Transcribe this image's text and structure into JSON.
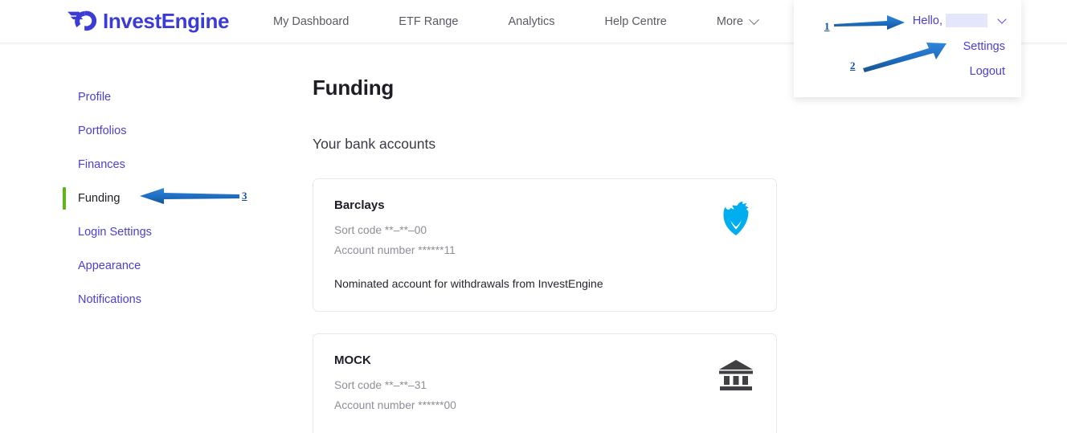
{
  "header": {
    "brand_name": "InvestEngine",
    "brand_logo_icon": "investengine-swoosh-ring-logo",
    "nav": [
      {
        "label": "My Dashboard",
        "icon": null
      },
      {
        "label": "ETF Range",
        "icon": null
      },
      {
        "label": "Analytics",
        "icon": null
      },
      {
        "label": "Help Centre",
        "icon": null
      },
      {
        "label": "More",
        "icon": "chevron-down-icon"
      }
    ]
  },
  "user_menu": {
    "greeting": "Hello,",
    "username_redacted": "",
    "chevron_icon": "chevron-down-icon",
    "items": [
      {
        "label": "Settings"
      },
      {
        "label": "Logout"
      }
    ]
  },
  "sidebar": {
    "items": [
      {
        "label": "Profile",
        "active": false
      },
      {
        "label": "Portfolios",
        "active": false
      },
      {
        "label": "Finances",
        "active": false
      },
      {
        "label": "Funding",
        "active": true
      },
      {
        "label": "Login Settings",
        "active": false
      },
      {
        "label": "Appearance",
        "active": false
      },
      {
        "label": "Notifications",
        "active": false
      }
    ],
    "active_indicator_color": "#61b517"
  },
  "main": {
    "page_title": "Funding",
    "section_title": "Your bank accounts",
    "accounts": [
      {
        "name": "Barclays",
        "sort_code": "Sort code **–**–00",
        "account_number": "Account number ******11",
        "note": "Nominated account for withdrawals from InvestEngine",
        "logo_icon": "barclays-eagle-icon",
        "logo_color": "#00AEEF"
      },
      {
        "name": "MOCK",
        "sort_code": "Sort code **–**–31",
        "account_number": "Account number ******00",
        "note": "",
        "logo_icon": "bank-building-icon",
        "logo_color": "#3f3f44"
      }
    ]
  },
  "annotations": {
    "color": "#1f6fc4",
    "markers": [
      {
        "number": "1",
        "points_to": "user-menu-hello",
        "direction": "right"
      },
      {
        "number": "2",
        "points_to": "user-menu-settings",
        "direction": "up-right"
      },
      {
        "number": "3",
        "points_to": "sidebar-item-funding",
        "direction": "left"
      }
    ]
  },
  "colors": {
    "link": "#4a3fd4",
    "brand": "#3b3bd6",
    "accent_green": "#61b517",
    "annotation_blue": "#1f6fc4",
    "redaction": "#e4e7fb"
  }
}
